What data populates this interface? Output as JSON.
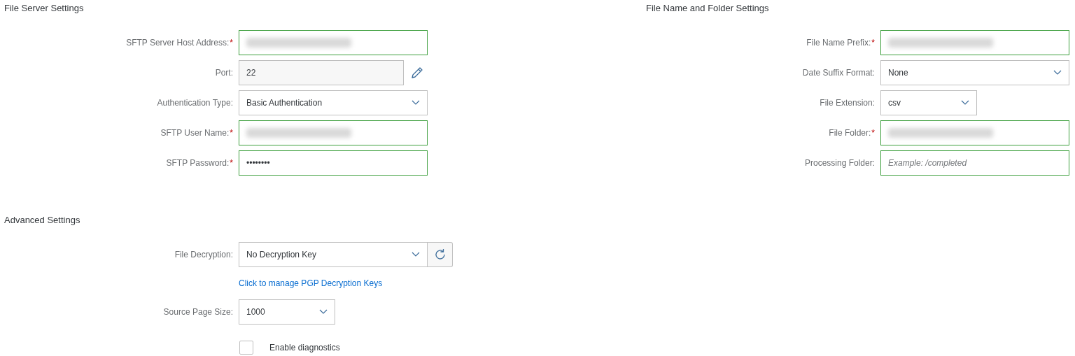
{
  "sections": [
    {
      "title": "File Server Settings",
      "fields": [
        {
          "kind": "text",
          "label": "SFTP Server Host Address:",
          "required_mark": "*",
          "redacted": true,
          "valid": true
        },
        {
          "kind": "locked",
          "label": "Port:",
          "value": "22"
        },
        {
          "kind": "select",
          "label": "Authentication Type:",
          "value": "Basic Authentication"
        },
        {
          "kind": "text",
          "label": "SFTP User Name:",
          "required_mark": "*",
          "redacted": true,
          "valid": true
        },
        {
          "kind": "text",
          "label": "SFTP Password:",
          "required_mark": "*",
          "value": "••••••••",
          "valid": true
        }
      ]
    },
    {
      "title": "File Name and Folder Settings",
      "fields": [
        {
          "kind": "text",
          "label": "File Name Prefix:",
          "required_mark": "*",
          "redacted": true,
          "valid": true
        },
        {
          "kind": "select",
          "label": "Date Suffix Format:",
          "value": "None"
        },
        {
          "kind": "short-select",
          "label": "File Extension:",
          "value": "csv"
        },
        {
          "kind": "text",
          "label": "File Folder:",
          "required_mark": "*",
          "redacted": true,
          "valid": true
        },
        {
          "kind": "text",
          "label": "Processing Folder:",
          "placeholder": "Example: /completed",
          "valid": true
        }
      ]
    },
    {
      "title": "Advanced Settings",
      "fields": [
        {
          "kind": "select-refresh",
          "label": "File Decryption:",
          "value": "No Decryption Key"
        },
        {
          "kind": "link",
          "text": "Click to manage PGP Decryption Keys"
        },
        {
          "kind": "short-select",
          "label": "Source Page Size:",
          "value": "1000"
        },
        {
          "kind": "checkbox",
          "text": "Enable diagnostics",
          "checked": false
        }
      ]
    }
  ]
}
